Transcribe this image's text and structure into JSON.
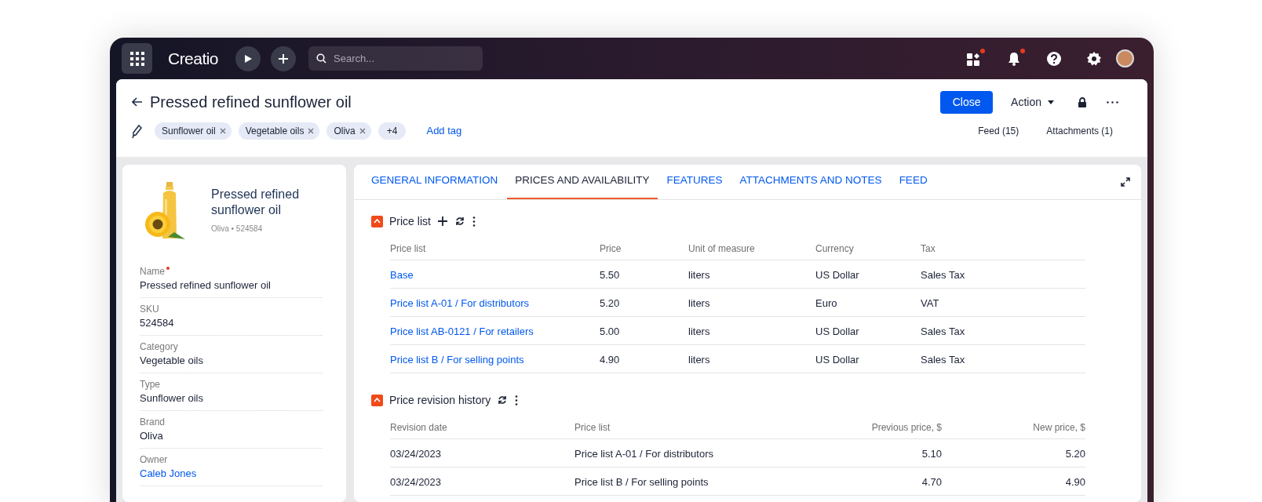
{
  "topbar": {
    "logo": "Creatio",
    "search": {
      "placeholder": "Search..."
    },
    "icons": [
      {
        "kind": "apps",
        "badge": true
      },
      {
        "kind": "bell",
        "badge": true
      },
      {
        "kind": "help",
        "badge": false
      },
      {
        "kind": "settings",
        "badge": false
      }
    ]
  },
  "header": {
    "title": "Pressed refined sunflower oil",
    "close_button": "Close",
    "action_button": "Action",
    "tags": [
      {
        "label": "Sunflower oil",
        "removable": true
      },
      {
        "label": "Vegetable oils",
        "removable": true
      },
      {
        "label": "Oliva",
        "removable": true
      },
      {
        "label": "+4",
        "removable": false
      }
    ],
    "add_tag": "Add tag",
    "links": [
      "Feed (15)",
      "Attachments (1)"
    ]
  },
  "profile": {
    "title": "Pressed refined sunflower oil",
    "subtitle": "Oliva • 524584",
    "fields": [
      {
        "label": "Name",
        "required": true,
        "value": "Pressed refined sunflower oil",
        "link": false
      },
      {
        "label": "SKU",
        "required": false,
        "value": "524584",
        "link": false
      },
      {
        "label": "Category",
        "required": false,
        "value": "Vegetable oils",
        "link": false
      },
      {
        "label": "Type",
        "required": false,
        "value": "Sunflower oils",
        "link": false
      },
      {
        "label": "Brand",
        "required": false,
        "value": "Oliva",
        "link": false
      },
      {
        "label": "Owner",
        "required": false,
        "value": "Caleb Jones",
        "link": true
      }
    ]
  },
  "tabs": [
    {
      "label": "GENERAL INFORMATION",
      "selected": false
    },
    {
      "label": "PRICES AND AVAILABILITY",
      "selected": true
    },
    {
      "label": "FEATURES",
      "selected": false
    },
    {
      "label": "ATTACHMENTS AND NOTES",
      "selected": false
    },
    {
      "label": "FEED",
      "selected": false
    }
  ],
  "price_list": {
    "title": "Price list",
    "expanded": true,
    "columns": [
      "Price list",
      "Price",
      "Unit of measure",
      "Currency",
      "Tax"
    ],
    "rows": [
      [
        "Base",
        "5.50",
        "liters",
        "US Dollar",
        "Sales Tax"
      ],
      [
        "Price list A-01 / For distributors",
        "5.20",
        "liters",
        "Euro",
        "VAT"
      ],
      [
        "Price list AB-0121 / For retailers",
        "5.00",
        "liters",
        "US Dollar",
        "Sales Tax"
      ],
      [
        "Price list B / For selling points",
        "4.90",
        "liters",
        "US Dollar",
        "Sales Tax"
      ]
    ]
  },
  "revision_history": {
    "title": "Price revision history",
    "expanded": true,
    "columns": [
      "Revision date",
      "Price list",
      "Previous price, $",
      "New price, $"
    ],
    "rows": [
      [
        "03/24/2023",
        "Price list A-01 / For distributors",
        "5.10",
        "5.20"
      ],
      [
        "03/24/2023",
        "Price list B / For selling points",
        "4.70",
        "4.90"
      ]
    ]
  }
}
